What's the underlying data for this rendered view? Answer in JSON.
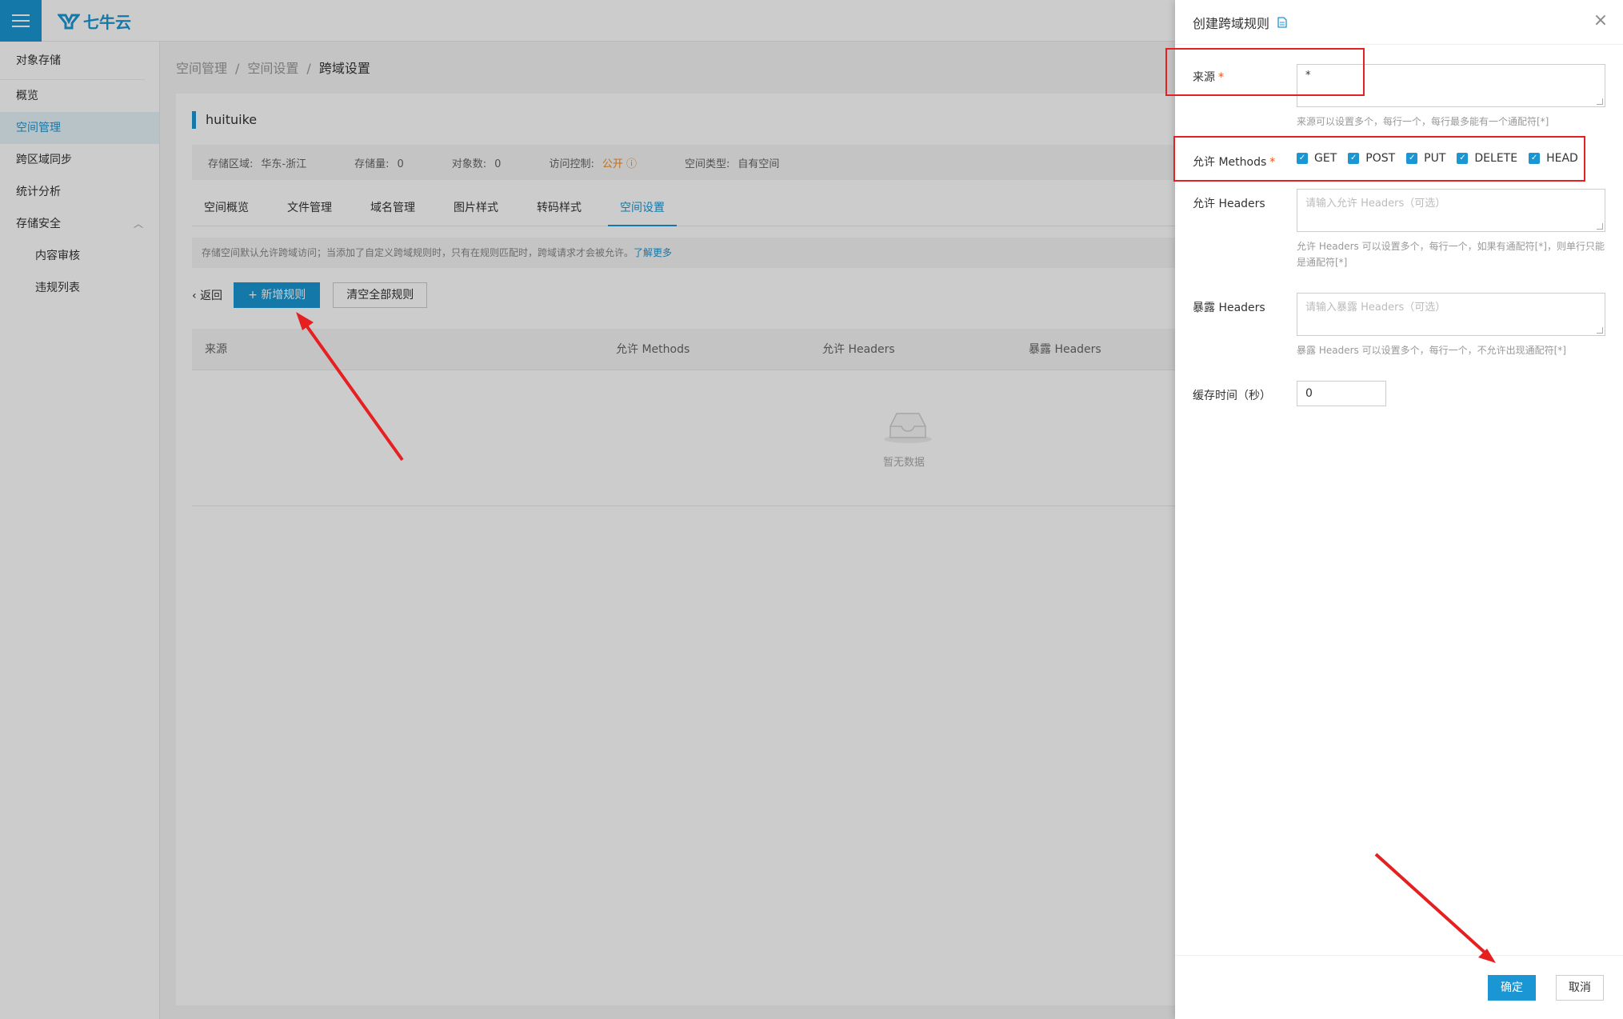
{
  "app": {
    "logo_text": "七牛云"
  },
  "sidebar": {
    "title": "对象存储",
    "items": [
      {
        "label": "概览"
      },
      {
        "label": "空间管理"
      },
      {
        "label": "跨区域同步"
      },
      {
        "label": "统计分析"
      },
      {
        "label": "存储安全"
      }
    ],
    "sub_items": [
      {
        "label": "内容审核"
      },
      {
        "label": "违规列表"
      }
    ]
  },
  "breadcrumb": {
    "items": [
      "空间管理",
      "空间设置"
    ],
    "current": "跨域设置",
    "sep": "/"
  },
  "bucket": {
    "name": "huituike",
    "region_label": "存储区域:",
    "region_value": "华东-浙江",
    "storage_label": "存储量:",
    "storage_value": "0",
    "objects_label": "对象数:",
    "objects_value": "0",
    "access_label": "访问控制:",
    "access_value": "公开",
    "type_label": "空间类型:",
    "type_value": "自有空间"
  },
  "tabs": [
    "空间概览",
    "文件管理",
    "域名管理",
    "图片样式",
    "转码样式",
    "空间设置"
  ],
  "notice": {
    "text": "存储空间默认允许跨域访问；当添加了自定义跨域规则时，只有在规则匹配时，跨域请求才会被允许。",
    "link": "了解更多"
  },
  "actions": {
    "back": "返回",
    "add": "新增规则",
    "clear": "清空全部规则"
  },
  "table": {
    "headers": [
      "来源",
      "允许 Methods",
      "允许 Headers",
      "暴露 Headers"
    ],
    "empty_text": "暂无数据"
  },
  "drawer": {
    "title": "创建跨域规则",
    "source_label": "来源",
    "source_value": "*",
    "source_hint": "来源可以设置多个，每行一个，每行最多能有一个通配符[*]",
    "methods_label": "允许 Methods",
    "methods": [
      "GET",
      "POST",
      "PUT",
      "DELETE",
      "HEAD"
    ],
    "allow_headers_label": "允许 Headers",
    "allow_headers_placeholder": "请输入允许 Headers（可选）",
    "allow_headers_hint": "允许 Headers 可以设置多个，每行一个，如果有通配符[*]，则单行只能是通配符[*]",
    "expose_headers_label": "暴露 Headers",
    "expose_headers_placeholder": "请输入暴露 Headers（可选）",
    "expose_headers_hint": "暴露 Headers 可以设置多个，每行一个，不允许出现通配符[*]",
    "cache_label": "缓存时间（秒）",
    "cache_value": "0",
    "ok": "确定",
    "cancel": "取消"
  },
  "colors": {
    "brand": "#1a96d4",
    "annotation": "#e62020",
    "warning": "#f08c1e"
  }
}
